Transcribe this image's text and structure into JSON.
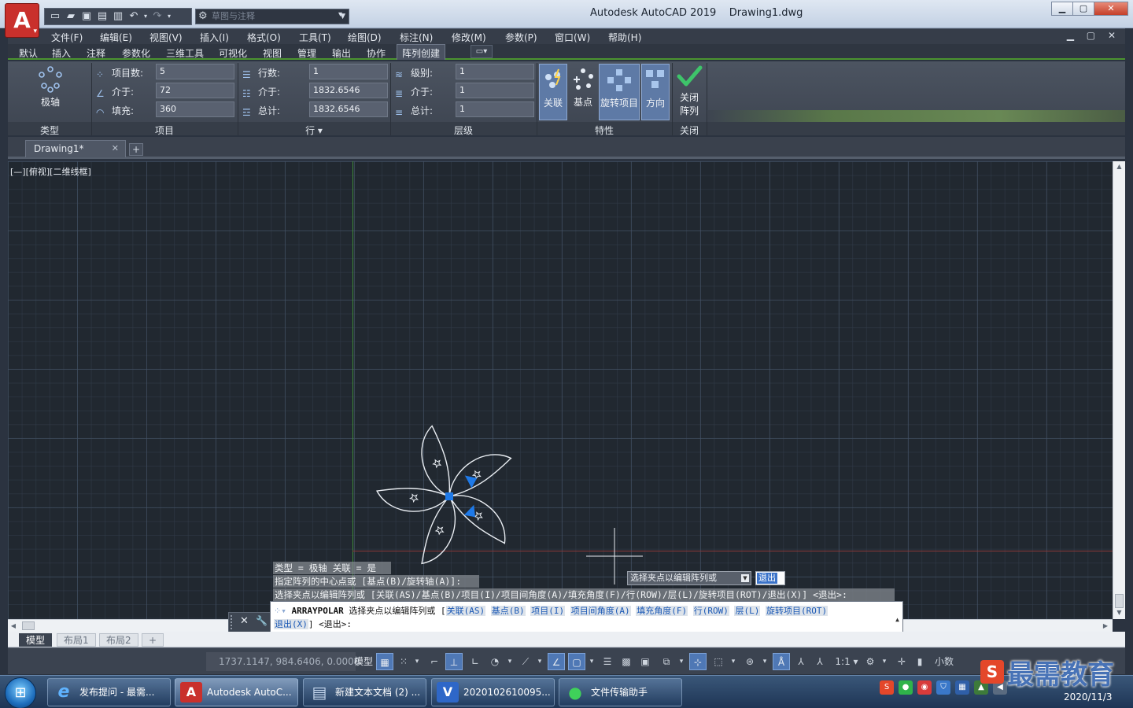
{
  "window": {
    "app_title": "Autodesk AutoCAD 2019    Drawing1.dwg",
    "app_logo": "A",
    "workspace_placeholder": "草图与注释",
    "controls": {
      "minimize": "▁",
      "maximize": "▢",
      "close": "✕"
    }
  },
  "menu": {
    "items": [
      "文件(F)",
      "编辑(E)",
      "视图(V)",
      "插入(I)",
      "格式(O)",
      "工具(T)",
      "绘图(D)",
      "标注(N)",
      "修改(M)",
      "参数(P)",
      "窗口(W)",
      "帮助(H)"
    ],
    "mdi_controls": "▁ ▢ ✕"
  },
  "ribbon_tabs": {
    "items": [
      "默认",
      "插入",
      "注释",
      "参数化",
      "三维工具",
      "可视化",
      "视图",
      "管理",
      "输出",
      "协作",
      "阵列创建"
    ],
    "active": "阵列创建",
    "extra_button": "▭▾"
  },
  "ribbon": {
    "type_panel": {
      "button": "极轴",
      "label": "类型"
    },
    "items_panel": {
      "label": "项目",
      "rows": [
        {
          "label": "项目数:",
          "value": "5"
        },
        {
          "label": "介于:",
          "value": "72"
        },
        {
          "label": "填充:",
          "value": "360"
        }
      ]
    },
    "rows_panel": {
      "label": "行 ▾",
      "rows": [
        {
          "label": "行数:",
          "value": "1"
        },
        {
          "label": "介于:",
          "value": "1832.6546"
        },
        {
          "label": "总计:",
          "value": "1832.6546"
        }
      ]
    },
    "levels_panel": {
      "label": "层级",
      "rows": [
        {
          "label": "级别:",
          "value": "1"
        },
        {
          "label": "介于:",
          "value": "1"
        },
        {
          "label": "总计:",
          "value": "1"
        }
      ]
    },
    "properties_panel": {
      "label": "特性",
      "buttons": [
        {
          "label": "关联",
          "on": true
        },
        {
          "label": "基点",
          "on": false
        },
        {
          "label": "旋转项目",
          "on": true
        },
        {
          "label": "方向",
          "on": true
        }
      ]
    },
    "close_panel": {
      "button_line1": "关闭",
      "button_line2": "阵列",
      "label": "关闭"
    },
    "accent_color": "#4b9430"
  },
  "document": {
    "tab": "Drawing1*",
    "tab_close": "✕",
    "new_tab": "+",
    "viewport_label": "[—][俯视][二维线框]"
  },
  "command": {
    "history": [
      "类型 = 极轴  关联 = 是",
      "指定阵列的中心点或 [基点(B)/旋转轴(A)]:",
      "选择夹点以编辑阵列或 [关联(AS)/基点(B)/项目(I)/项目间角度(A)/填充角度(F)/行(ROW)/层(L)/旋转项目(ROT)/退出(X)] <退出>:"
    ],
    "dynamic_prompt": "选择夹点以编辑阵列或",
    "dynamic_option": "退出",
    "command_name": "ARRAYPOLAR",
    "prompt_text": "选择夹点以编辑阵列或 [",
    "options": [
      "关联(AS)",
      "基点(B)",
      "项目(I)",
      "项目间角度(A)",
      "填充角度(F)",
      "行(ROW)",
      "层(L)",
      "旋转项目(ROT)"
    ],
    "exit_option": "退出(X)",
    "tail": "] <退出>:",
    "close_icon": "✕",
    "customize_icon": "🔧"
  },
  "layout_tabs": [
    "模型",
    "布局1",
    "布局2",
    "+"
  ],
  "status": {
    "coords": "1737.1147, 984.6406, 0.0000",
    "model": "模型",
    "scale": "1:1 ▾",
    "units": "小数"
  },
  "watermark": {
    "logo": "S",
    "text": "最需教育"
  },
  "taskbar": {
    "tasks": [
      {
        "label": "发布提问 - 最需...",
        "icon": "e",
        "color": "#2b7fd6"
      },
      {
        "label": "Autodesk AutoC...",
        "icon": "A",
        "color": "#c9302c"
      },
      {
        "label": "新建文本文档 (2) ...",
        "icon": "▤",
        "color": "#6f8fb5"
      },
      {
        "label": "2020102610095...",
        "icon": "V",
        "color": "#2e67c8"
      },
      {
        "label": "文件传输助手",
        "icon": "●",
        "color": "#2fb34a"
      }
    ],
    "clock_date": "2020/11/3"
  },
  "drawing": {
    "petal_color": "#e9edf2",
    "grip_color": "#1f7ae8",
    "axis_x_color": "#8a3737",
    "axis_y_color": "#3f8a3a"
  }
}
